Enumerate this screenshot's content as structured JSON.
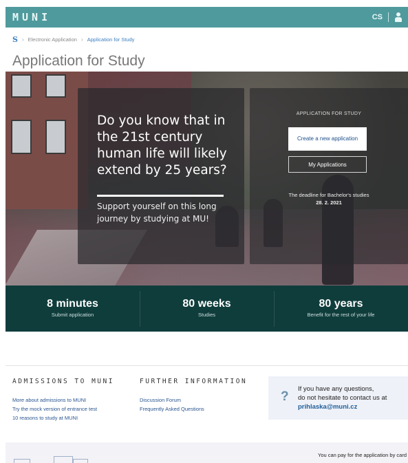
{
  "header": {
    "logo": "MUNI",
    "lang": "CS"
  },
  "breadcrumb": {
    "items": [
      "Electronic Application",
      "Application for Study"
    ]
  },
  "page": {
    "title": "Application for Study"
  },
  "hero": {
    "question": "Do you know that in the 21st century human life will likely extend by 25 years?",
    "support": "Support yourself on this long journey by studying at MU!",
    "app_label": "APPLICATION FOR STUDY",
    "create_button": "Create a new application",
    "my_apps_button": "My Applications",
    "deadline_text": "The deadline for Bachelor's studies",
    "deadline_date": "28. 2. 2021"
  },
  "stats": [
    {
      "value": "8 minutes",
      "label": "Submit application"
    },
    {
      "value": "80 weeks",
      "label": "Studies"
    },
    {
      "value": "80 years",
      "label": "Benefit for the rest of your life"
    }
  ],
  "footer": {
    "admissions": {
      "heading": "ADMISSIONS TO MUNI",
      "links": [
        "More about admissions to MUNI",
        "Try the mock version of entrance test",
        "10 reasons to study at MUNI"
      ]
    },
    "further": {
      "heading": "FURTHER INFORMATION",
      "links": [
        "Discussion Forum",
        "Frequently Asked Questions"
      ]
    },
    "help": {
      "line1": "If you have any questions,",
      "line2": "do not hesitate to contact us at",
      "email": "prihlaska@muni.cz"
    },
    "pay_text": "You can pay for the application by card"
  },
  "colors": {
    "header": "#4f9a9d",
    "stats_band": "#0f3d3c",
    "link": "#2a5590"
  },
  "icons": {
    "home": "muni-home-icon",
    "help": "question-mark-icon",
    "user": "user-icon"
  }
}
